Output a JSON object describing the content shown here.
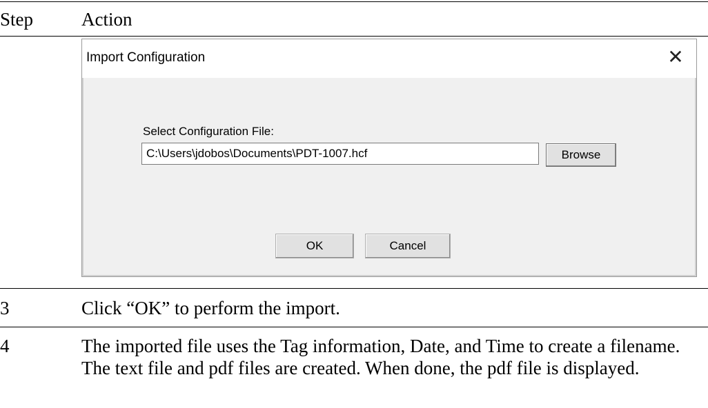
{
  "table": {
    "header": {
      "step": "Step",
      "action": "Action"
    },
    "rows": [
      {
        "step": "3",
        "action": "Click “OK” to perform the import."
      },
      {
        "step": "4",
        "action": "The imported file uses the Tag information, Date, and Time to create a filename.  The text file and pdf files are created.  When done, the pdf file is displayed."
      }
    ]
  },
  "dialog": {
    "title": "Import Configuration",
    "close_glyph": "✕",
    "field_label": "Select Configuration File:",
    "file_path": "C:\\Users\\jdobos\\Documents\\PDT-1007.hcf",
    "browse_label": "Browse",
    "ok_label": "OK",
    "cancel_label": "Cancel"
  }
}
